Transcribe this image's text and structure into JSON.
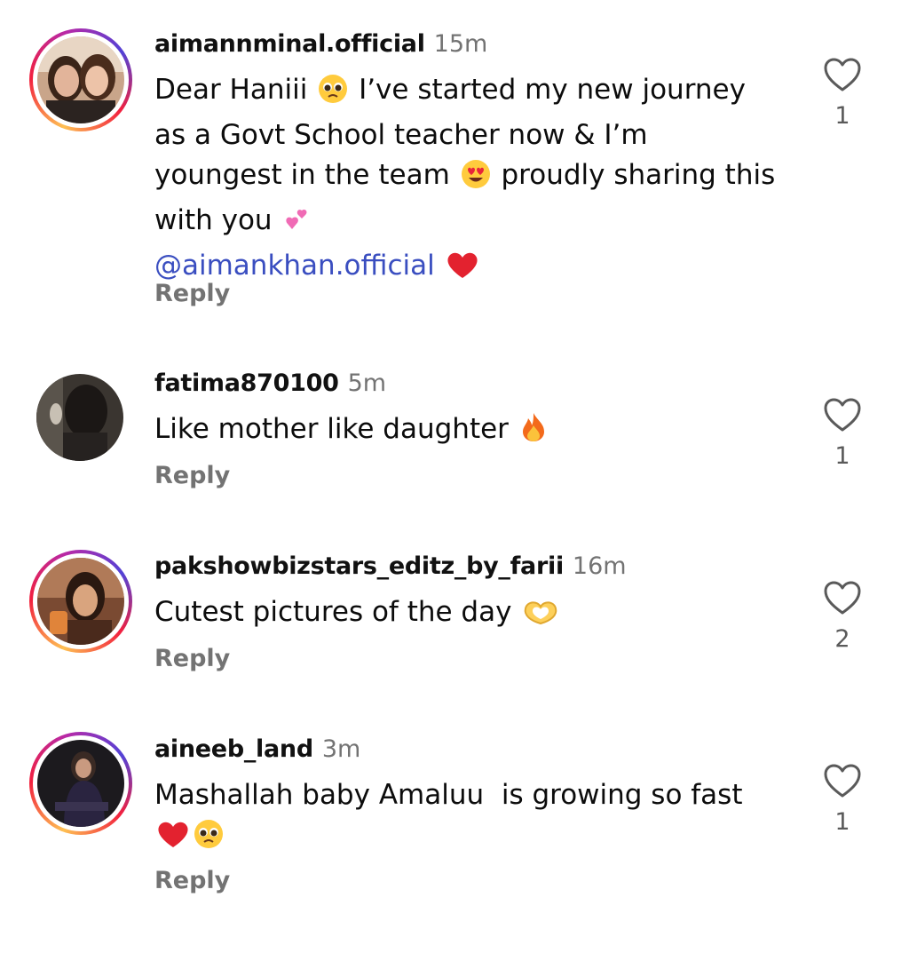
{
  "comments": [
    {
      "username": "aimannminal.official",
      "time": "15m",
      "text_1": "Dear Haniii",
      "text_2": "I’ve started my new journey as a Govt School teacher now & I’m youngest in the team",
      "text_3": "proudly sharing this with you",
      "mention": "@aimankhan.official",
      "reply": "Reply",
      "likes": "1"
    },
    {
      "username": "fatima870100",
      "time": "5m",
      "text_1": "Like mother like daughter",
      "reply": "Reply",
      "likes": "1"
    },
    {
      "username": "pakshowbizstars_editz_by_farii",
      "time": "16m",
      "text_1": "Cutest pictures of the day",
      "reply": "Reply",
      "likes": "2"
    },
    {
      "username": "aineeb_land",
      "time": "3m",
      "text_1": "Mashallah baby Amaluu  is growing so fast",
      "reply": "Reply",
      "likes": "1"
    }
  ]
}
